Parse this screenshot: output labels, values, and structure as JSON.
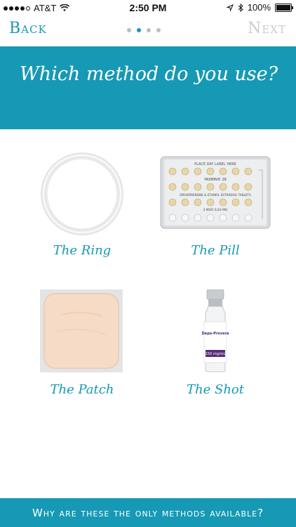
{
  "status": {
    "carrier": "AT&T",
    "time": "2:50 PM",
    "battery": "100%"
  },
  "nav": {
    "back_label": "Back",
    "next_label": "Next",
    "page_indicator": {
      "total": 4,
      "current": 2
    }
  },
  "header": {
    "title": "Which method do you use?"
  },
  "methods": [
    {
      "label": "The Ring",
      "icon": "ring-image"
    },
    {
      "label": "The Pill",
      "icon": "pill-pack-image"
    },
    {
      "label": "The Patch",
      "icon": "patch-image"
    },
    {
      "label": "The Shot",
      "icon": "vial-image"
    }
  ],
  "pill_pack": {
    "top_label": "PLACE DAY LABEL HERE",
    "brand": "YASMIN® 28",
    "ingredients": "DROSPIRENONE & ETHINYL ESTRADIOL TABLETS",
    "bottom_label": "3 MGR 0,03 MG"
  },
  "vial": {
    "brand": "Depo-Provera",
    "dose": "150 mg/mL"
  },
  "footer": {
    "link_label": "Why are these the only methods available?"
  },
  "colors": {
    "accent": "#1699b5",
    "disabled": "#c9cdd0"
  }
}
